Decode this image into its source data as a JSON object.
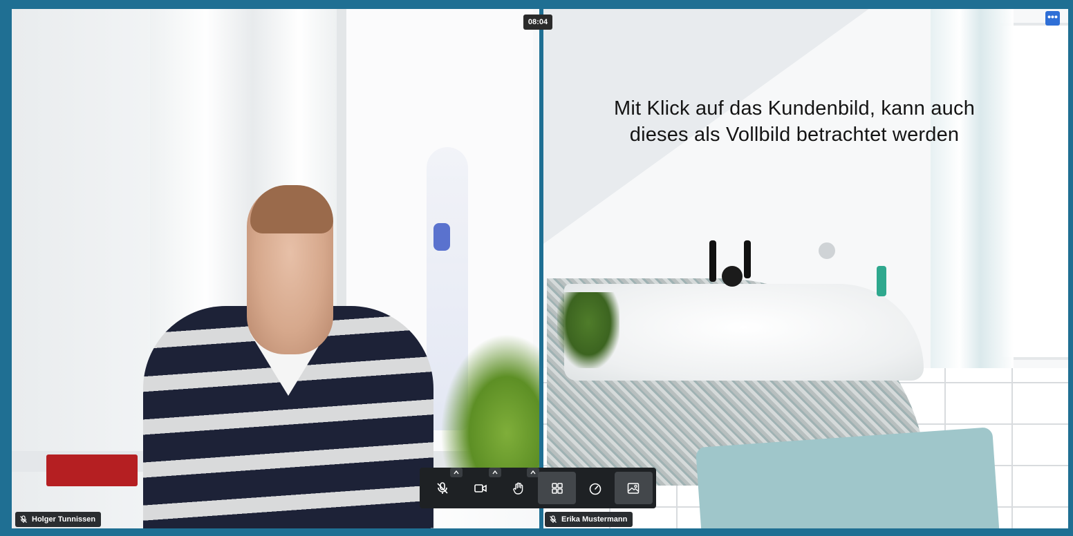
{
  "meeting": {
    "timer": "08:04",
    "more_button": "•••",
    "caption_line1": "Mit Klick auf das Kundenbild, kann auch",
    "caption_line2": "dieses als Vollbild betrachtet werden"
  },
  "participants": [
    {
      "name": "Holger Tunnissen",
      "mic_icon": "mic-muted-icon"
    },
    {
      "name": "Erika Mustermann",
      "mic_icon": "mic-muted-icon"
    }
  ],
  "toolbar": {
    "buttons": [
      {
        "icon": "mic-off-icon",
        "has_caret": true
      },
      {
        "icon": "camera-icon",
        "has_caret": true
      },
      {
        "icon": "raise-hand-icon",
        "has_caret": true
      },
      {
        "icon": "grid-view-icon",
        "active": true
      },
      {
        "icon": "speedometer-icon"
      },
      {
        "icon": "background-image-icon",
        "active": true
      }
    ]
  },
  "colors": {
    "frame": "#1f6f93",
    "toolbar_bg": "#1e2124",
    "more_button": "#2f6fd6"
  }
}
